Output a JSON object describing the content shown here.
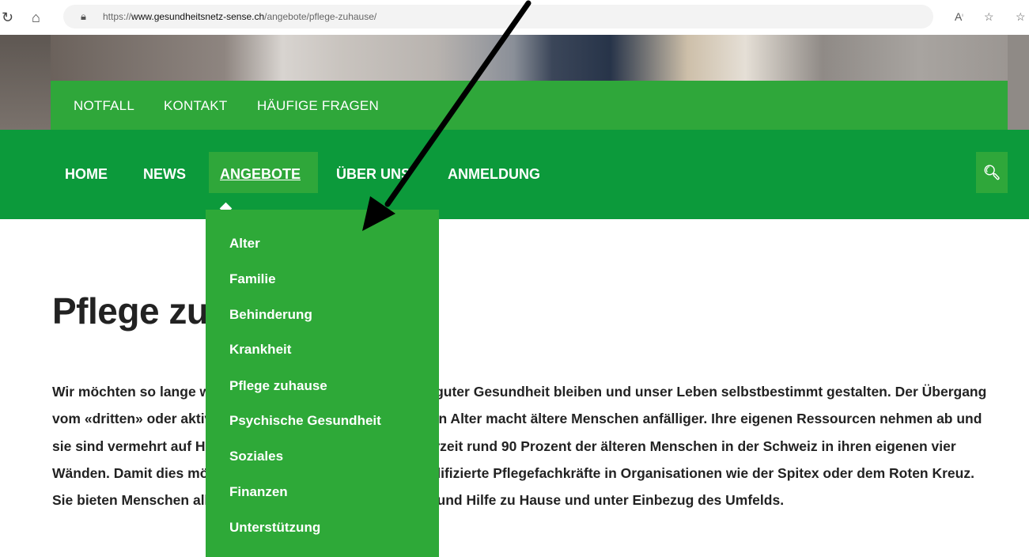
{
  "browser": {
    "url_protocol": "https://",
    "url_domain": "www.gesundheitsnetz-sense.ch",
    "url_path": "/angebote/pflege-zuhause/",
    "reload_icon": "reload-icon",
    "home_icon": "home-icon",
    "lock_icon": "lock-icon",
    "read_aloud_icon": "read-aloud-icon",
    "favorite_icon": "add-favorite-icon"
  },
  "top_links": [
    "NOTFALL",
    "KONTAKT",
    "HÄUFIGE FRAGEN"
  ],
  "nav": {
    "items": [
      "HOME",
      "NEWS",
      "ANGEBOTE",
      "ÜBER UNS",
      "ANMELDUNG"
    ],
    "active": "ANGEBOTE",
    "search_icon": "search-icon"
  },
  "dropdown": {
    "items": [
      "Alter",
      "Familie",
      "Behinderung",
      "Krankheit",
      "Pflege zuhause",
      "Psychische Gesundheit",
      "Soziales",
      "Finanzen",
      "Unterstützung"
    ]
  },
  "page": {
    "title": "Pflege zuhause",
    "paragraph": "Wir möchten so lange wie möglich selbstständig sein, bei guter Gesundheit bleiben und unser Leben selbstbestimmt gestalten. Der Übergang vom «dritten» oder aktiven Alter zum «vierten» oder fragilen Alter macht ältere Menschen anfälliger. Ihre eigenen Ressourcen nehmen ab und sie sind vermehrt auf Hilfe angewiesen. Dennoch leben derzeit rund 90 Prozent der älteren Menschen in der Schweiz in ihren eigenen vier Wänden. Damit dies möglich ist, engagieren sich viele qualifizierte Pflegefachkräfte in Organisationen wie der Spitex oder dem Roten Kreuz. Sie bieten Menschen aller Altersgruppen Pflege, Beratung und Hilfe zu Hause und unter Einbezug des Umfelds."
  },
  "colors": {
    "nav_green": "#0c9a3b",
    "light_green": "#2fa73a",
    "arrow": "#000000"
  }
}
